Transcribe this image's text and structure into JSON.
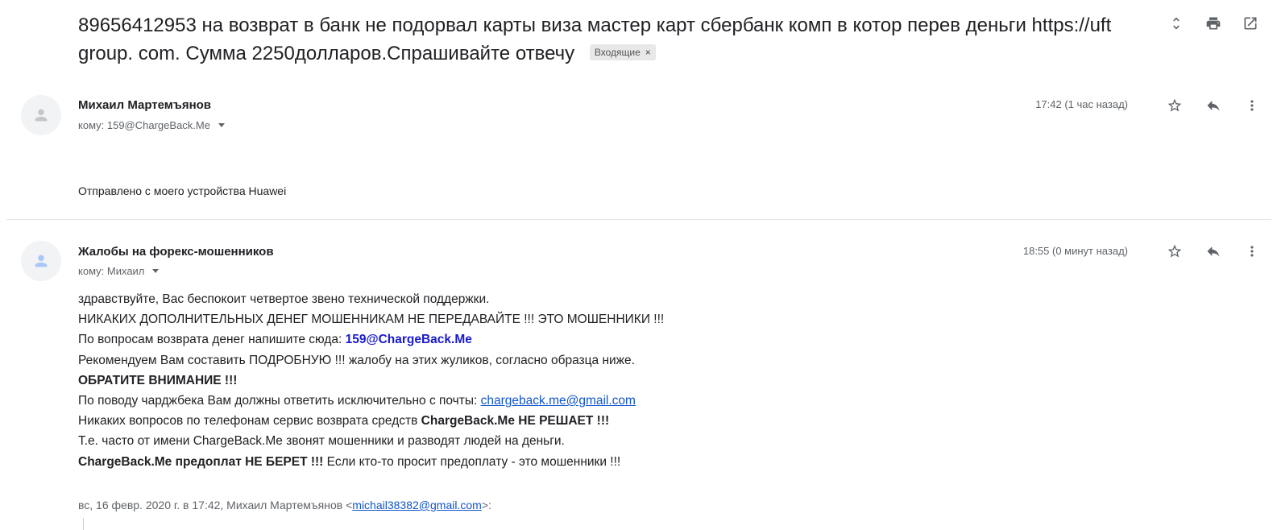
{
  "subject": {
    "text": "89656412953 на возврат в банк не подорвал карты виза мастер карт сбербанк комп в котор перев деньги https://uft group. com. Сумма 2250долларов.Спрашивайте отвечу",
    "label": "Входящие",
    "label_close": "×"
  },
  "toolbar_icons": [
    "expand-collapse-icon",
    "print-icon",
    "open-in-new-window-icon"
  ],
  "messages": [
    {
      "sender": "Михаил Мартемъянов",
      "recipient": "кому: 159@ChargeBack.Me",
      "time": "17:42 (1 час назад)",
      "body": "Отправлено с моего устройства Huawei"
    },
    {
      "sender": "Жалобы на форекс-мошенников",
      "recipient": "кому: Михаил",
      "time": "18:55 (0 минут назад)",
      "lines": {
        "l1": "здравствуйте, Вас беспокоит четвертое звено технической поддержки.",
        "l2": "НИКАКИХ ДОПОЛНИТЕЛЬНЫХ ДЕНЕГ МОШЕННИКАМ НЕ ПЕРЕДАВАЙТЕ !!! ЭТО МОШЕННИКИ !!!",
        "l3_prefix": "По вопросам возврата денег напишите сюда: ",
        "l3_email": "159@ChargeBack.Me",
        "l4": "Рекомендуем Вам составить ПОДРОБНУЮ !!! жалобу на этих жуликов, согласно образца ниже.",
        "l5": "ОБРАТИТЕ ВНИМАНИЕ !!!",
        "l6_prefix": "По поводу чарджбека Вам должны ответить исключительно с почты: ",
        "l6_link": "chargeback.me@gmail.com",
        "l7_prefix": "Никаких вопросов по телефонам сервис возврата средств ",
        "l7_bold": "ChargeBack.Me НЕ РЕШАЕТ !!!",
        "l8": "Т.е. часто от имени ChargeBack.Me звонят мошенники и разводят людей на деньги.",
        "l9_bold": "ChargeBack.Me предоплат НЕ БЕРЕТ !!!",
        "l9_suffix": " Если кто-то просит предоплату - это мошенники !!!"
      },
      "quote": {
        "prefix": "вс, 16 февр. 2020 г. в 17:42, Михаил Мартемъянов <",
        "email": "michail38382@gmail.com",
        "suffix": ">:"
      }
    }
  ],
  "colors": {
    "link": "#1155cc",
    "highlight_email": "#1a1acc",
    "icon_gray": "#5f6368"
  }
}
